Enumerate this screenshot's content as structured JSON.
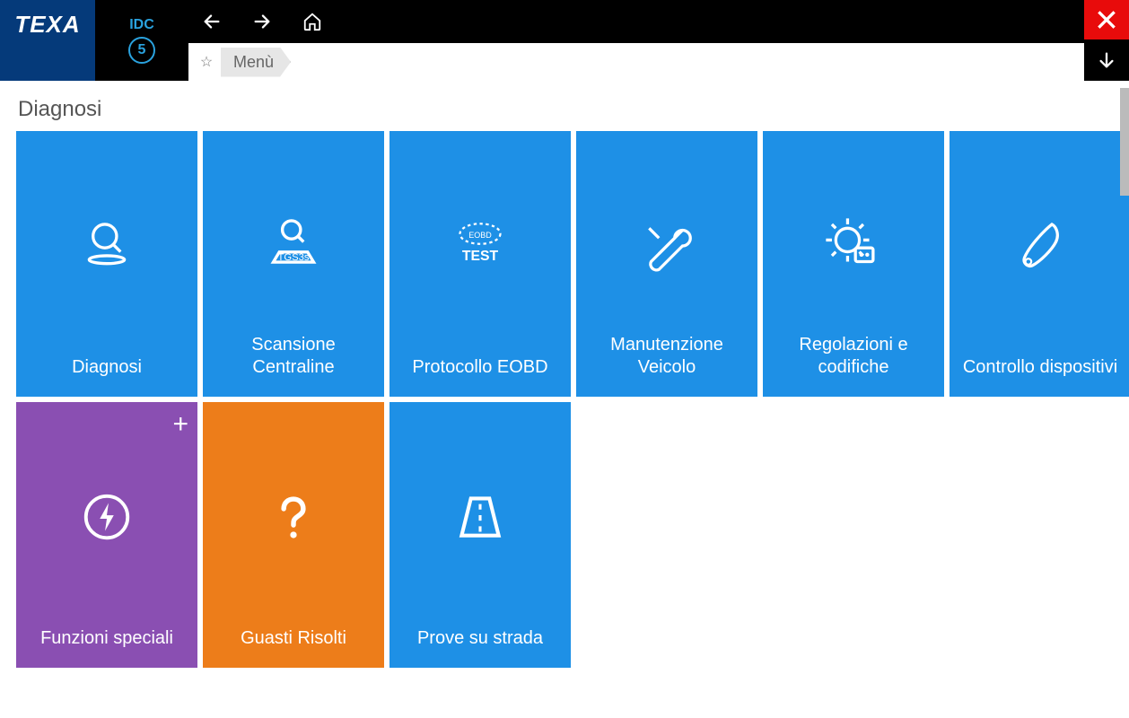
{
  "brand": {
    "logo": "TEXA",
    "app_name": "IDC",
    "app_ver": "5"
  },
  "breadcrumb": {
    "item": "Menù"
  },
  "page": {
    "title": "Diagnosi"
  },
  "tiles": [
    {
      "label": "Diagnosi",
      "color": "blue",
      "icon": "diagnosis-icon",
      "plus": false
    },
    {
      "label": "Scansione Centraline",
      "color": "blue",
      "icon": "ecu-scan-icon",
      "plus": false
    },
    {
      "label": "Protocollo EOBD",
      "color": "blue",
      "icon": "eobd-test-icon",
      "plus": false
    },
    {
      "label": "Manutenzione Veicolo",
      "color": "blue",
      "icon": "maintenance-icon",
      "plus": false
    },
    {
      "label": "Regolazioni e codifiche",
      "color": "blue",
      "icon": "settings-cog-icon",
      "plus": false
    },
    {
      "label": "Controllo dispositivi",
      "color": "blue",
      "icon": "device-check-icon",
      "plus": false
    },
    {
      "label": "Funzioni speciali",
      "color": "purple",
      "icon": "bolt-icon",
      "plus": true
    },
    {
      "label": "Guasti Risolti",
      "color": "orange",
      "icon": "question-icon",
      "plus": false
    },
    {
      "label": "Prove su strada",
      "color": "blue",
      "icon": "road-test-icon",
      "plus": false
    }
  ]
}
